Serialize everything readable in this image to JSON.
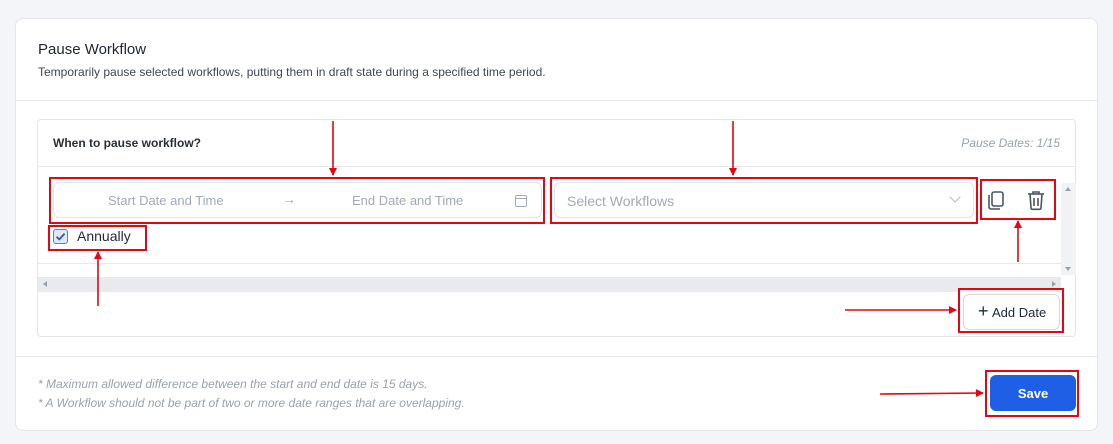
{
  "header": {
    "title": "Pause Workflow",
    "subtitle": "Temporarily pause selected workflows, putting them in draft state during a specified time period."
  },
  "schedule": {
    "heading": "When to pause workflow?",
    "pause_dates": "Pause Dates: 1/15",
    "date_range": {
      "start_placeholder": "Start Date and Time",
      "arrow": "→",
      "end_placeholder": "End Date and Time",
      "icon": "calendar-icon"
    },
    "workflow_select": {
      "placeholder": "Select Workflows",
      "icon": "chevron-down-icon"
    },
    "actions": {
      "copy_icon": "copy-icon",
      "delete_icon": "trash-icon"
    },
    "annually": {
      "label": "Annually",
      "checked": true
    },
    "add_date": {
      "plus": "+",
      "label": "Add Date"
    }
  },
  "footer": {
    "notes": [
      "* Maximum allowed difference between the start and end date is 15 days.",
      "* A Workflow should not be part of two or more date ranges that are overlapping."
    ],
    "save_label": "Save"
  },
  "colors": {
    "primary": "#1e5fe6",
    "annotation": "#e30613"
  }
}
